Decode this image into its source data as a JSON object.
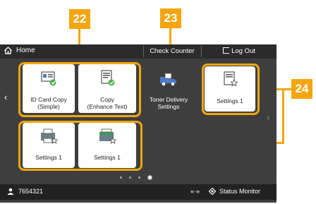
{
  "topbar": {
    "home_label": "Home",
    "check_counter_label": "Check Counter",
    "logout_label": "Log Out"
  },
  "tiles": [
    {
      "line1": "ID Card Copy",
      "line2": "(Simple)"
    },
    {
      "line1": "Copy",
      "line2": "(Enhance Text)"
    },
    {
      "line1": "Toner Delivery",
      "line2": "Settings"
    },
    {
      "line1": "Settings 1",
      "line2": ""
    },
    {
      "line1": "Settings 1",
      "line2": ""
    },
    {
      "line1": "Settings 1",
      "line2": ""
    }
  ],
  "pagination": {
    "pages": 4,
    "current": 4
  },
  "bottombar": {
    "user_id": "7654321",
    "status_monitor_label": "Status Monitor"
  },
  "callouts": [
    "22",
    "23",
    "24"
  ],
  "colors": {
    "accent": "#f3a60f",
    "screen_bg": "#3e3e3e",
    "bar_bg": "#2b2b2b"
  }
}
